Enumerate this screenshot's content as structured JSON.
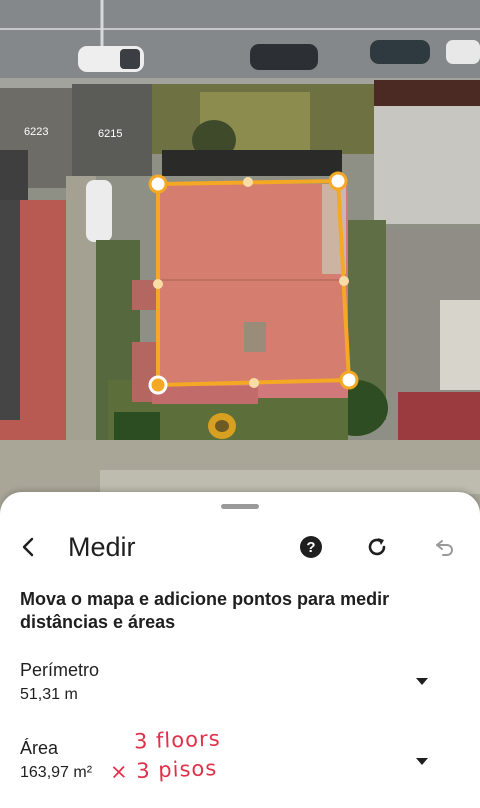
{
  "map": {
    "parcel_labels": [
      "6223",
      "6215"
    ],
    "measure_color": "#f4a823"
  },
  "sheet": {
    "title": "Medir",
    "instructions": "Mova o mapa e adicione pontos para medir distâncias e áreas",
    "perimeter": {
      "label": "Perímetro",
      "value": "51,31 m"
    },
    "area": {
      "label": "Área",
      "value": "163,97 m²"
    },
    "annotations": {
      "line1": "3 floors",
      "line2": "× 3 pisos"
    },
    "icons": {
      "back": "chevron-left-icon",
      "help": "help-icon",
      "redo": "redo-icon",
      "undo": "undo-icon",
      "expand": "caret-down-icon"
    }
  }
}
